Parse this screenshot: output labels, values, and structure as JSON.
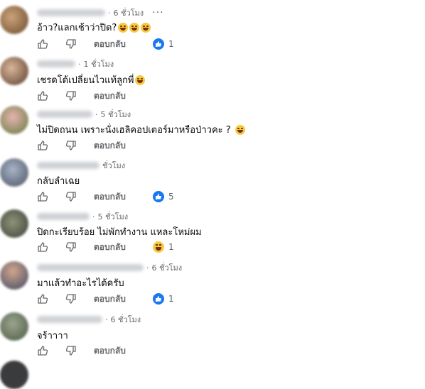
{
  "ui": {
    "reply_label": "ตอบกลับ",
    "more_label": "···"
  },
  "comments": [
    {
      "time": "6 ชั่วโมง",
      "text": "อ้าว?แลกเช้าว่าปิด?",
      "emoji_count": 3,
      "reaction": "like",
      "reaction_count": "1"
    },
    {
      "time": "1 ชั่วโมง",
      "text": "เชรดโด้เปลี่ยนไวแท้ลูกพี่",
      "emoji_count": 1,
      "reaction": "",
      "reaction_count": ""
    },
    {
      "time": "5 ชั่วโมง",
      "text": "ไม่ปิดถนน เพราะนั่งเฮลิคอปเตอร์มาหรือป่าวคะ ?",
      "emoji_count": 1,
      "reaction": "",
      "reaction_count": ""
    },
    {
      "time": "ชั่วโมง",
      "text": "กลับลำเฉย",
      "emoji_count": 0,
      "reaction": "like",
      "reaction_count": "5"
    },
    {
      "time": "5 ชั่วโมง",
      "text": "ปิดกะเรียบร้อย ไม่พักทำงาน แหละโหม่ผม",
      "emoji_count": 0,
      "reaction": "haha",
      "reaction_count": "1"
    },
    {
      "time": "6 ชั่วโมง",
      "text": "มาแล้วทำอะไรได้ครับ",
      "emoji_count": 0,
      "reaction": "like",
      "reaction_count": "1"
    },
    {
      "time": "6 ชั่วโมง",
      "text": "จร้าาาา",
      "emoji_count": 0,
      "reaction": "",
      "reaction_count": ""
    }
  ],
  "colors": {
    "accent": "#1877f2",
    "secondary_text": "#65676b",
    "text": "#050505"
  }
}
